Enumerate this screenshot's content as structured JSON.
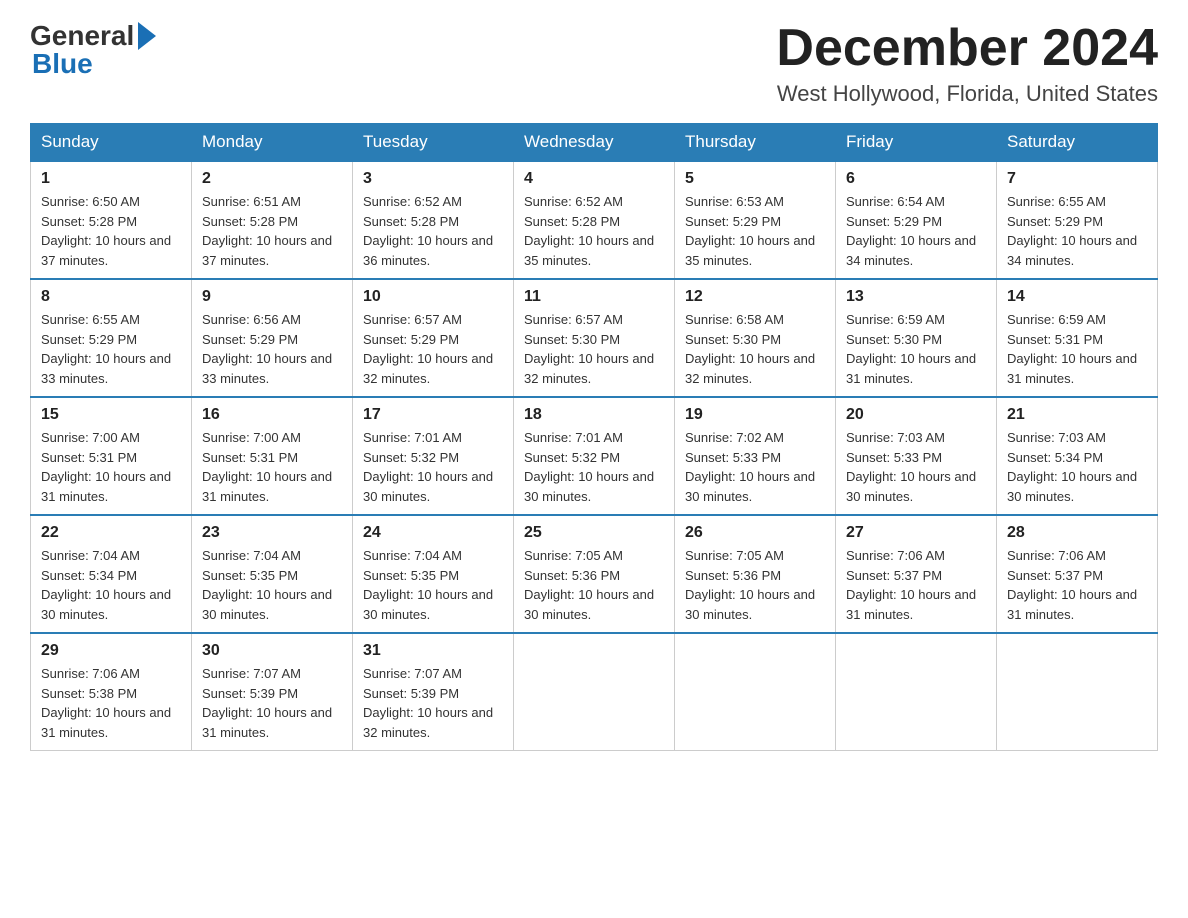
{
  "header": {
    "logo_general": "General",
    "logo_blue": "Blue",
    "month_title": "December 2024",
    "location": "West Hollywood, Florida, United States"
  },
  "days_of_week": [
    "Sunday",
    "Monday",
    "Tuesday",
    "Wednesday",
    "Thursday",
    "Friday",
    "Saturday"
  ],
  "weeks": [
    [
      {
        "day": "1",
        "sunrise": "6:50 AM",
        "sunset": "5:28 PM",
        "daylight": "10 hours and 37 minutes."
      },
      {
        "day": "2",
        "sunrise": "6:51 AM",
        "sunset": "5:28 PM",
        "daylight": "10 hours and 37 minutes."
      },
      {
        "day": "3",
        "sunrise": "6:52 AM",
        "sunset": "5:28 PM",
        "daylight": "10 hours and 36 minutes."
      },
      {
        "day": "4",
        "sunrise": "6:52 AM",
        "sunset": "5:28 PM",
        "daylight": "10 hours and 35 minutes."
      },
      {
        "day": "5",
        "sunrise": "6:53 AM",
        "sunset": "5:29 PM",
        "daylight": "10 hours and 35 minutes."
      },
      {
        "day": "6",
        "sunrise": "6:54 AM",
        "sunset": "5:29 PM",
        "daylight": "10 hours and 34 minutes."
      },
      {
        "day": "7",
        "sunrise": "6:55 AM",
        "sunset": "5:29 PM",
        "daylight": "10 hours and 34 minutes."
      }
    ],
    [
      {
        "day": "8",
        "sunrise": "6:55 AM",
        "sunset": "5:29 PM",
        "daylight": "10 hours and 33 minutes."
      },
      {
        "day": "9",
        "sunrise": "6:56 AM",
        "sunset": "5:29 PM",
        "daylight": "10 hours and 33 minutes."
      },
      {
        "day": "10",
        "sunrise": "6:57 AM",
        "sunset": "5:29 PM",
        "daylight": "10 hours and 32 minutes."
      },
      {
        "day": "11",
        "sunrise": "6:57 AM",
        "sunset": "5:30 PM",
        "daylight": "10 hours and 32 minutes."
      },
      {
        "day": "12",
        "sunrise": "6:58 AM",
        "sunset": "5:30 PM",
        "daylight": "10 hours and 32 minutes."
      },
      {
        "day": "13",
        "sunrise": "6:59 AM",
        "sunset": "5:30 PM",
        "daylight": "10 hours and 31 minutes."
      },
      {
        "day": "14",
        "sunrise": "6:59 AM",
        "sunset": "5:31 PM",
        "daylight": "10 hours and 31 minutes."
      }
    ],
    [
      {
        "day": "15",
        "sunrise": "7:00 AM",
        "sunset": "5:31 PM",
        "daylight": "10 hours and 31 minutes."
      },
      {
        "day": "16",
        "sunrise": "7:00 AM",
        "sunset": "5:31 PM",
        "daylight": "10 hours and 31 minutes."
      },
      {
        "day": "17",
        "sunrise": "7:01 AM",
        "sunset": "5:32 PM",
        "daylight": "10 hours and 30 minutes."
      },
      {
        "day": "18",
        "sunrise": "7:01 AM",
        "sunset": "5:32 PM",
        "daylight": "10 hours and 30 minutes."
      },
      {
        "day": "19",
        "sunrise": "7:02 AM",
        "sunset": "5:33 PM",
        "daylight": "10 hours and 30 minutes."
      },
      {
        "day": "20",
        "sunrise": "7:03 AM",
        "sunset": "5:33 PM",
        "daylight": "10 hours and 30 minutes."
      },
      {
        "day": "21",
        "sunrise": "7:03 AM",
        "sunset": "5:34 PM",
        "daylight": "10 hours and 30 minutes."
      }
    ],
    [
      {
        "day": "22",
        "sunrise": "7:04 AM",
        "sunset": "5:34 PM",
        "daylight": "10 hours and 30 minutes."
      },
      {
        "day": "23",
        "sunrise": "7:04 AM",
        "sunset": "5:35 PM",
        "daylight": "10 hours and 30 minutes."
      },
      {
        "day": "24",
        "sunrise": "7:04 AM",
        "sunset": "5:35 PM",
        "daylight": "10 hours and 30 minutes."
      },
      {
        "day": "25",
        "sunrise": "7:05 AM",
        "sunset": "5:36 PM",
        "daylight": "10 hours and 30 minutes."
      },
      {
        "day": "26",
        "sunrise": "7:05 AM",
        "sunset": "5:36 PM",
        "daylight": "10 hours and 30 minutes."
      },
      {
        "day": "27",
        "sunrise": "7:06 AM",
        "sunset": "5:37 PM",
        "daylight": "10 hours and 31 minutes."
      },
      {
        "day": "28",
        "sunrise": "7:06 AM",
        "sunset": "5:37 PM",
        "daylight": "10 hours and 31 minutes."
      }
    ],
    [
      {
        "day": "29",
        "sunrise": "7:06 AM",
        "sunset": "5:38 PM",
        "daylight": "10 hours and 31 minutes."
      },
      {
        "day": "30",
        "sunrise": "7:07 AM",
        "sunset": "5:39 PM",
        "daylight": "10 hours and 31 minutes."
      },
      {
        "day": "31",
        "sunrise": "7:07 AM",
        "sunset": "5:39 PM",
        "daylight": "10 hours and 32 minutes."
      },
      null,
      null,
      null,
      null
    ]
  ]
}
